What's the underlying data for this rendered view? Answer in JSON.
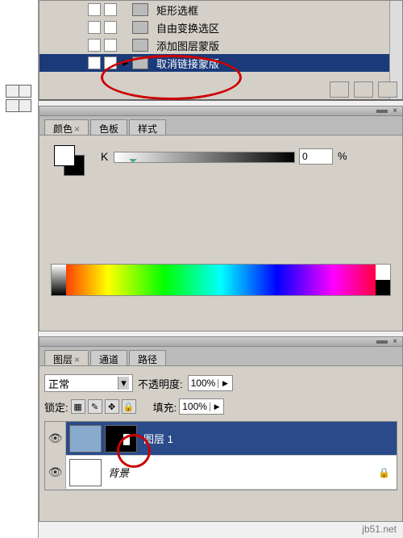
{
  "history": {
    "items": [
      {
        "label": "矩形选框"
      },
      {
        "label": "自由变换选区"
      },
      {
        "label": "添加图层蒙版"
      },
      {
        "label": "取消链接蒙版"
      }
    ]
  },
  "color_panel": {
    "tabs": [
      "颜色",
      "色板",
      "样式"
    ],
    "k_label": "K",
    "k_value": "0",
    "k_pct": "%"
  },
  "layers_panel": {
    "tabs": [
      "图层",
      "通道",
      "路径"
    ],
    "blend_mode": "正常",
    "opacity_label": "不透明度:",
    "opacity_value": "100%",
    "lock_label": "锁定:",
    "fill_label": "填充:",
    "fill_value": "100%",
    "layers": [
      {
        "name": "图层 1",
        "has_mask": true,
        "selected": true
      },
      {
        "name": "背景",
        "locked": true,
        "italic": true
      }
    ]
  },
  "watermark": "jb51.net"
}
